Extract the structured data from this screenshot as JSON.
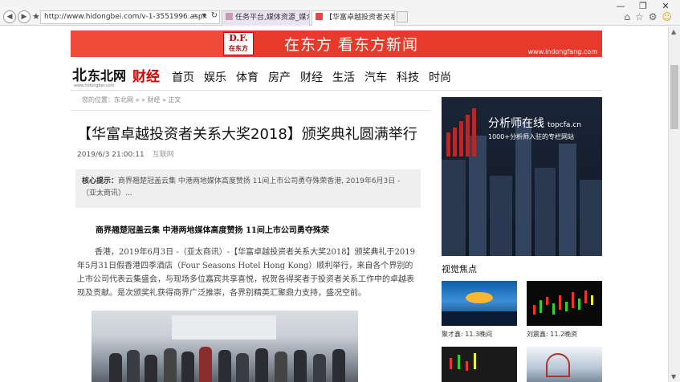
{
  "browser": {
    "url": "http://www.hidongbei.com/v-1-3551996.aspx",
    "tabs": [
      {
        "label": "任务平台,媒体资源_媒介资源..."
      },
      {
        "label": "【华富卓越投资者关系大奖..."
      }
    ],
    "win_minimize": "—",
    "win_restore": "❐",
    "win_close": "✕"
  },
  "banner": {
    "badge_top": "D.F.",
    "badge_bottom": "在东方",
    "slogan": "在东方  看东方新闻",
    "site": "www.indongfang.com"
  },
  "header": {
    "logo_mark": "北",
    "logo_name": "东北网",
    "logo_sub": "www.hidongbei.com",
    "section": "财经",
    "nav": [
      "首页",
      "娱乐",
      "体育",
      "房产",
      "财经",
      "生活",
      "汽车",
      "科技",
      "时尚"
    ]
  },
  "breadcrumb": "您的位置：东北网 » » 财经 » 正文",
  "article": {
    "title": "【华富卓越投资者关系大奖2018】颁奖典礼圆满举行",
    "date": "2019/6/3 21:00:11",
    "source": "互联网",
    "summary_label": "核心提示：",
    "summary_text": "商界翘楚冠盖云集 中港两地媒体高度赞扬 11间上市公司勇夺殊荣香港, 2019年6月3日 -（亚太商讯）...",
    "lead": "商界翘楚冠盖云集 中港两地媒体高度赞扬 11间上市公司勇夺殊荣",
    "body": "香港，2019年6月3日 -（亚太商讯）-【华富卓越投资者关系大奖2018】颁奖典礼于2019年5月31日假香港四季酒店（Four Seasons Hotel Hong Kong）顺利举行，来自各个界别的上市公司代表云集盛会，与现场多位嘉宾共享喜悦，祝贺各得奖者于投资者关系工作中的卓越表现及贡献。是次颁奖礼获得商界广泛推崇，各界别精英汇聚鼎力支持，盛况空前。"
  },
  "sidebar": {
    "ad_brand": "分析师在线",
    "ad_domain": "topcfa.cn",
    "ad_tagline": "1000+分析师入驻的专栏网站",
    "focus_title": "视觉焦点",
    "items": [
      {
        "caption": "聚才鑫: 11.3晚间"
      },
      {
        "caption": "刘震鑫: 11.2晚资"
      }
    ]
  },
  "colors": {
    "accent": "#d40000",
    "banner": "#e83a2c",
    "ad_bg": "#1a2536"
  }
}
